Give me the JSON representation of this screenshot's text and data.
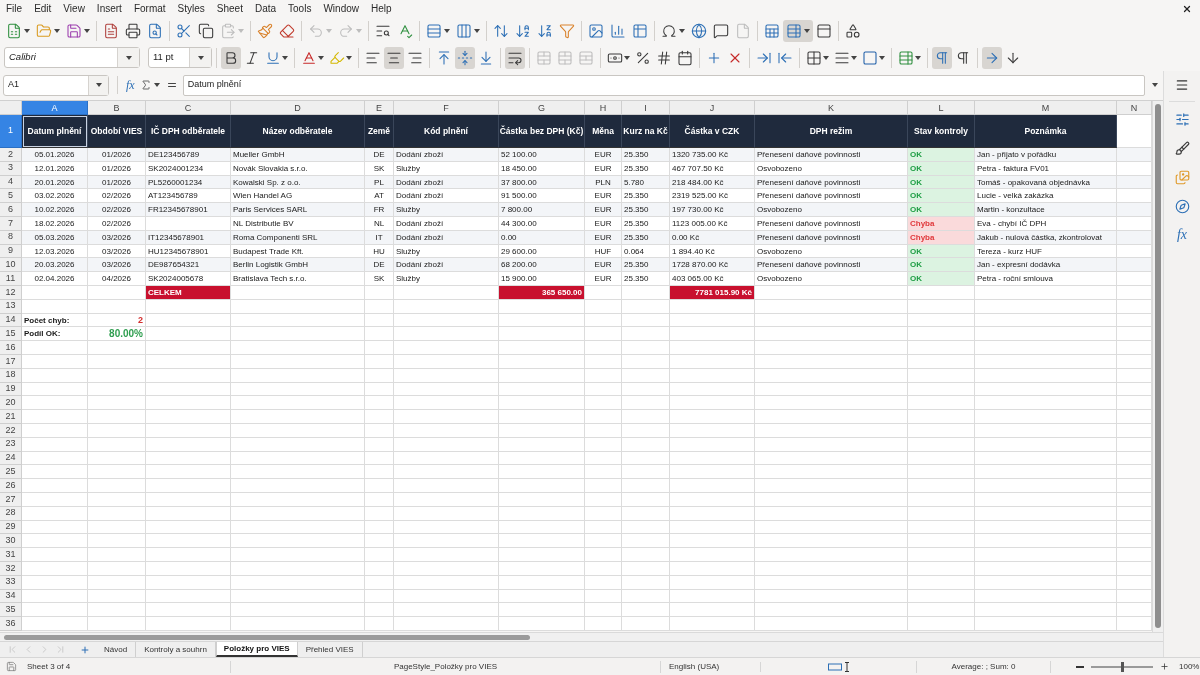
{
  "menu_bar": {
    "items": [
      "File",
      "Edit",
      "View",
      "Insert",
      "Format",
      "Styles",
      "Sheet",
      "Data",
      "Tools",
      "Window",
      "Help"
    ]
  },
  "standard_toolbar": {
    "paste": {
      "disabled": true
    },
    "undo": {
      "disabled": true
    },
    "redo": {
      "disabled": true
    },
    "headers_footers": {
      "disabled": true
    },
    "freeze_rows_columns": {
      "pressed": true
    }
  },
  "formatting_toolbar": {
    "font_name": "Calibri",
    "font_size": "11 pt",
    "bold": {
      "pressed": true
    },
    "italic": {
      "pressed": false
    },
    "underline": {
      "pressed": false
    },
    "align_left": {
      "pressed": false
    },
    "align_center": {
      "pressed": true
    },
    "align_right": {
      "pressed": false
    },
    "align_top": {
      "pressed": false
    },
    "align_middle": {
      "pressed": true
    },
    "align_bottom": {
      "pressed": false
    },
    "wrap_text": {
      "pressed": true
    },
    "merge_center": {
      "disabled": true
    },
    "merge": {
      "disabled": true
    },
    "unmerge": {
      "disabled": true
    },
    "left_to_right": {
      "pressed": true
    },
    "right_to_left": {
      "pressed": false
    },
    "text_horizontal": {
      "pressed": true
    },
    "text_vertical": {
      "pressed": false
    }
  },
  "formula_bar": {
    "cell_reference": "A1",
    "function_wizard": "fx",
    "content": "Datum plnění"
  },
  "sheet": {
    "columns": [
      {
        "label": "A",
        "selected": true
      },
      {
        "label": "B",
        "selected": false
      },
      {
        "label": "C",
        "selected": false
      },
      {
        "label": "D",
        "selected": false
      },
      {
        "label": "E",
        "selected": false
      },
      {
        "label": "F",
        "selected": false
      },
      {
        "label": "G",
        "selected": false
      },
      {
        "label": "H",
        "selected": false
      },
      {
        "label": "I",
        "selected": false
      },
      {
        "label": "J",
        "selected": false
      },
      {
        "label": "K",
        "selected": false
      },
      {
        "label": "L",
        "selected": false
      },
      {
        "label": "M",
        "selected": false
      },
      {
        "label": "N",
        "selected": false
      }
    ],
    "row_headers": [
      {
        "label": "1",
        "selected": true
      },
      {
        "label": "2",
        "selected": false
      },
      {
        "label": "3",
        "selected": false
      },
      {
        "label": "4",
        "selected": false
      },
      {
        "label": "5",
        "selected": false
      },
      {
        "label": "6",
        "selected": false
      },
      {
        "label": "7",
        "selected": false
      },
      {
        "label": "8",
        "selected": false
      },
      {
        "label": "9",
        "selected": false
      },
      {
        "label": "10",
        "selected": false
      },
      {
        "label": "11",
        "selected": false
      },
      {
        "label": "12",
        "selected": false
      },
      {
        "label": "13",
        "selected": false
      },
      {
        "label": "14",
        "selected": false
      },
      {
        "label": "15",
        "selected": false
      },
      {
        "label": "16",
        "selected": false
      },
      {
        "label": "17",
        "selected": false
      },
      {
        "label": "18",
        "selected": false
      },
      {
        "label": "19",
        "selected": false
      },
      {
        "label": "20",
        "selected": false
      },
      {
        "label": "21",
        "selected": false
      },
      {
        "label": "22",
        "selected": false
      },
      {
        "label": "23",
        "selected": false
      },
      {
        "label": "24",
        "selected": false
      },
      {
        "label": "25",
        "selected": false
      },
      {
        "label": "26",
        "selected": false
      },
      {
        "label": "27",
        "selected": false
      },
      {
        "label": "28",
        "selected": false
      },
      {
        "label": "29",
        "selected": false
      },
      {
        "label": "30",
        "selected": false
      },
      {
        "label": "31",
        "selected": false
      },
      {
        "label": "32",
        "selected": false
      },
      {
        "label": "33",
        "selected": false
      },
      {
        "label": "34",
        "selected": false
      },
      {
        "label": "35",
        "selected": false
      },
      {
        "label": "36",
        "selected": false
      }
    ],
    "header_row": [
      "Datum plnění",
      "Období VIES",
      "IČ DPH odběratele",
      "Název odběratele",
      "Země",
      "Kód plnění",
      "Částka bez DPH (Kč)",
      "Měna",
      "Kurz na Kč",
      "Částka v CZK",
      "DPH režim",
      "Stav kontroly",
      "Poznámka"
    ],
    "rows": [
      {
        "date": "05.01.2026",
        "period": "01/2026",
        "vat_id": "DE123456789",
        "customer": "Mueller GmbH",
        "country": "DE",
        "supply_code": "Dodání zboží",
        "amount": "52 100.00",
        "currency": "EUR",
        "rate": "25.350",
        "amount_czk": "1320 735.00 Kč",
        "vat_regime": "Přenesení daňové povinnosti",
        "status": {
          "text": "OK",
          "kind": "ok"
        },
        "note": "Jan - přijato v pořádku"
      },
      {
        "date": "12.01.2026",
        "period": "01/2026",
        "vat_id": "SK2024001234",
        "customer": "Novák Slovakia s.r.o.",
        "country": "SK",
        "supply_code": "Služby",
        "amount": "18 450.00",
        "currency": "EUR",
        "rate": "25.350",
        "amount_czk": "467 707.50 Kč",
        "vat_regime": "Osvobozeno",
        "status": {
          "text": "OK",
          "kind": "ok"
        },
        "note": "Petra - faktura FV01"
      },
      {
        "date": "20.01.2026",
        "period": "01/2026",
        "vat_id": "PL5260001234",
        "customer": "Kowalski Sp. z o.o.",
        "country": "PL",
        "supply_code": "Dodání zboží",
        "amount": "37 800.00",
        "currency": "PLN",
        "rate": "5.780",
        "amount_czk": "218 484.00 Kč",
        "vat_regime": "Přenesení daňové povinnosti",
        "status": {
          "text": "OK",
          "kind": "ok"
        },
        "note": "Tomáš - opakovaná objednávka"
      },
      {
        "date": "03.02.2026",
        "period": "02/2026",
        "vat_id": "AT123456789",
        "customer": "Wien Handel AG",
        "country": "AT",
        "supply_code": "Dodání zboží",
        "amount": "91 500.00",
        "currency": "EUR",
        "rate": "25.350",
        "amount_czk": "2319 525.00 Kč",
        "vat_regime": "Přenesení daňové povinnosti",
        "status": {
          "text": "OK",
          "kind": "ok"
        },
        "note": "Lucie - velká zakázka"
      },
      {
        "date": "10.02.2026",
        "period": "02/2026",
        "vat_id": "FR12345678901",
        "customer": "Paris Services SARL",
        "country": "FR",
        "supply_code": "Služby",
        "amount": "7 800.00",
        "currency": "EUR",
        "rate": "25.350",
        "amount_czk": "197 730.00 Kč",
        "vat_regime": "Osvobozeno",
        "status": {
          "text": "OK",
          "kind": "ok"
        },
        "note": "Martin - konzultace"
      },
      {
        "date": "18.02.2026",
        "period": "02/2026",
        "customer": "NL Distributie BV",
        "country": "NL",
        "supply_code": "Dodání zboží",
        "amount": "44 300.00",
        "currency": "EUR",
        "rate": "25.350",
        "amount_czk": "1123 005.00 Kč",
        "vat_regime": "Přenesení daňové povinnosti",
        "status": {
          "text": "Chyba",
          "kind": "error"
        },
        "note": "Eva - chybí IČ DPH"
      },
      {
        "date": "05.03.2026",
        "period": "03/2026",
        "vat_id": "IT12345678901",
        "customer": "Roma Componenti SRL",
        "country": "IT",
        "supply_code": "Dodání zboží",
        "amount": "0.00",
        "currency": "EUR",
        "rate": "25.350",
        "amount_czk": "0.00 Kč",
        "vat_regime": "Přenesení daňové povinnosti",
        "status": {
          "text": "Chyba",
          "kind": "error"
        },
        "note": "Jakub - nulová částka, zkontrolovat"
      },
      {
        "date": "12.03.2026",
        "period": "03/2026",
        "vat_id": "HU12345678901",
        "customer": "Budapest Trade Kft.",
        "country": "HU",
        "supply_code": "Služby",
        "amount": "29 600.00",
        "currency": "HUF",
        "rate": "0.064",
        "amount_czk": "1 894.40 Kč",
        "vat_regime": "Osvobozeno",
        "status": {
          "text": "OK",
          "kind": "ok"
        },
        "note": "Tereza - kurz HUF"
      },
      {
        "date": "20.03.2026",
        "period": "03/2026",
        "vat_id": "DE987654321",
        "customer": "Berlin Logistik GmbH",
        "country": "DE",
        "supply_code": "Dodání zboží",
        "amount": "68 200.00",
        "currency": "EUR",
        "rate": "25.350",
        "amount_czk": "1728 870.00 Kč",
        "vat_regime": "Přenesení daňové povinnosti",
        "status": {
          "text": "OK",
          "kind": "ok"
        },
        "note": "Jan - expresní dodávka"
      },
      {
        "date": "02.04.2026",
        "period": "04/2026",
        "vat_id": "SK2024005678",
        "customer": "Bratislava Tech s.r.o.",
        "country": "SK",
        "supply_code": "Služby",
        "amount": "15 900.00",
        "currency": "EUR",
        "rate": "25.350",
        "amount_czk": "403 065.00 Kč",
        "vat_regime": "Osvobozeno",
        "status": {
          "text": "OK",
          "kind": "ok"
        },
        "note": "Petra - roční smlouva"
      }
    ],
    "totals_row": {
      "label": "CELKEM",
      "amount": "365 650.00",
      "amount_czk": "7781 015.90 Kč"
    },
    "summary": [
      {
        "label": "Počet chyb:",
        "value": "2",
        "kind": "error"
      },
      {
        "label": "Podíl OK:",
        "value": "80.00%",
        "kind": "ok"
      }
    ]
  },
  "sheet_tab_navigation": {
    "disabled": true
  },
  "sheet_tabs": [
    {
      "label": "Návod",
      "selected": false
    },
    {
      "label": "Kontroly a souhrn",
      "selected": false
    },
    {
      "label": "Položky pro VIES",
      "selected": true
    },
    {
      "label": "Přehled VIES",
      "selected": false
    }
  ],
  "sidebar": {
    "functions_label": "fx"
  },
  "status_bar": {
    "sheet_position": "Sheet 3 of 4",
    "page_style": "PageStyle_Položky pro VIES",
    "language": "English (USA)",
    "selection_stats": "Average: ; Sum: 0",
    "zoom": {
      "level": 0.5,
      "reading": "100%"
    }
  }
}
